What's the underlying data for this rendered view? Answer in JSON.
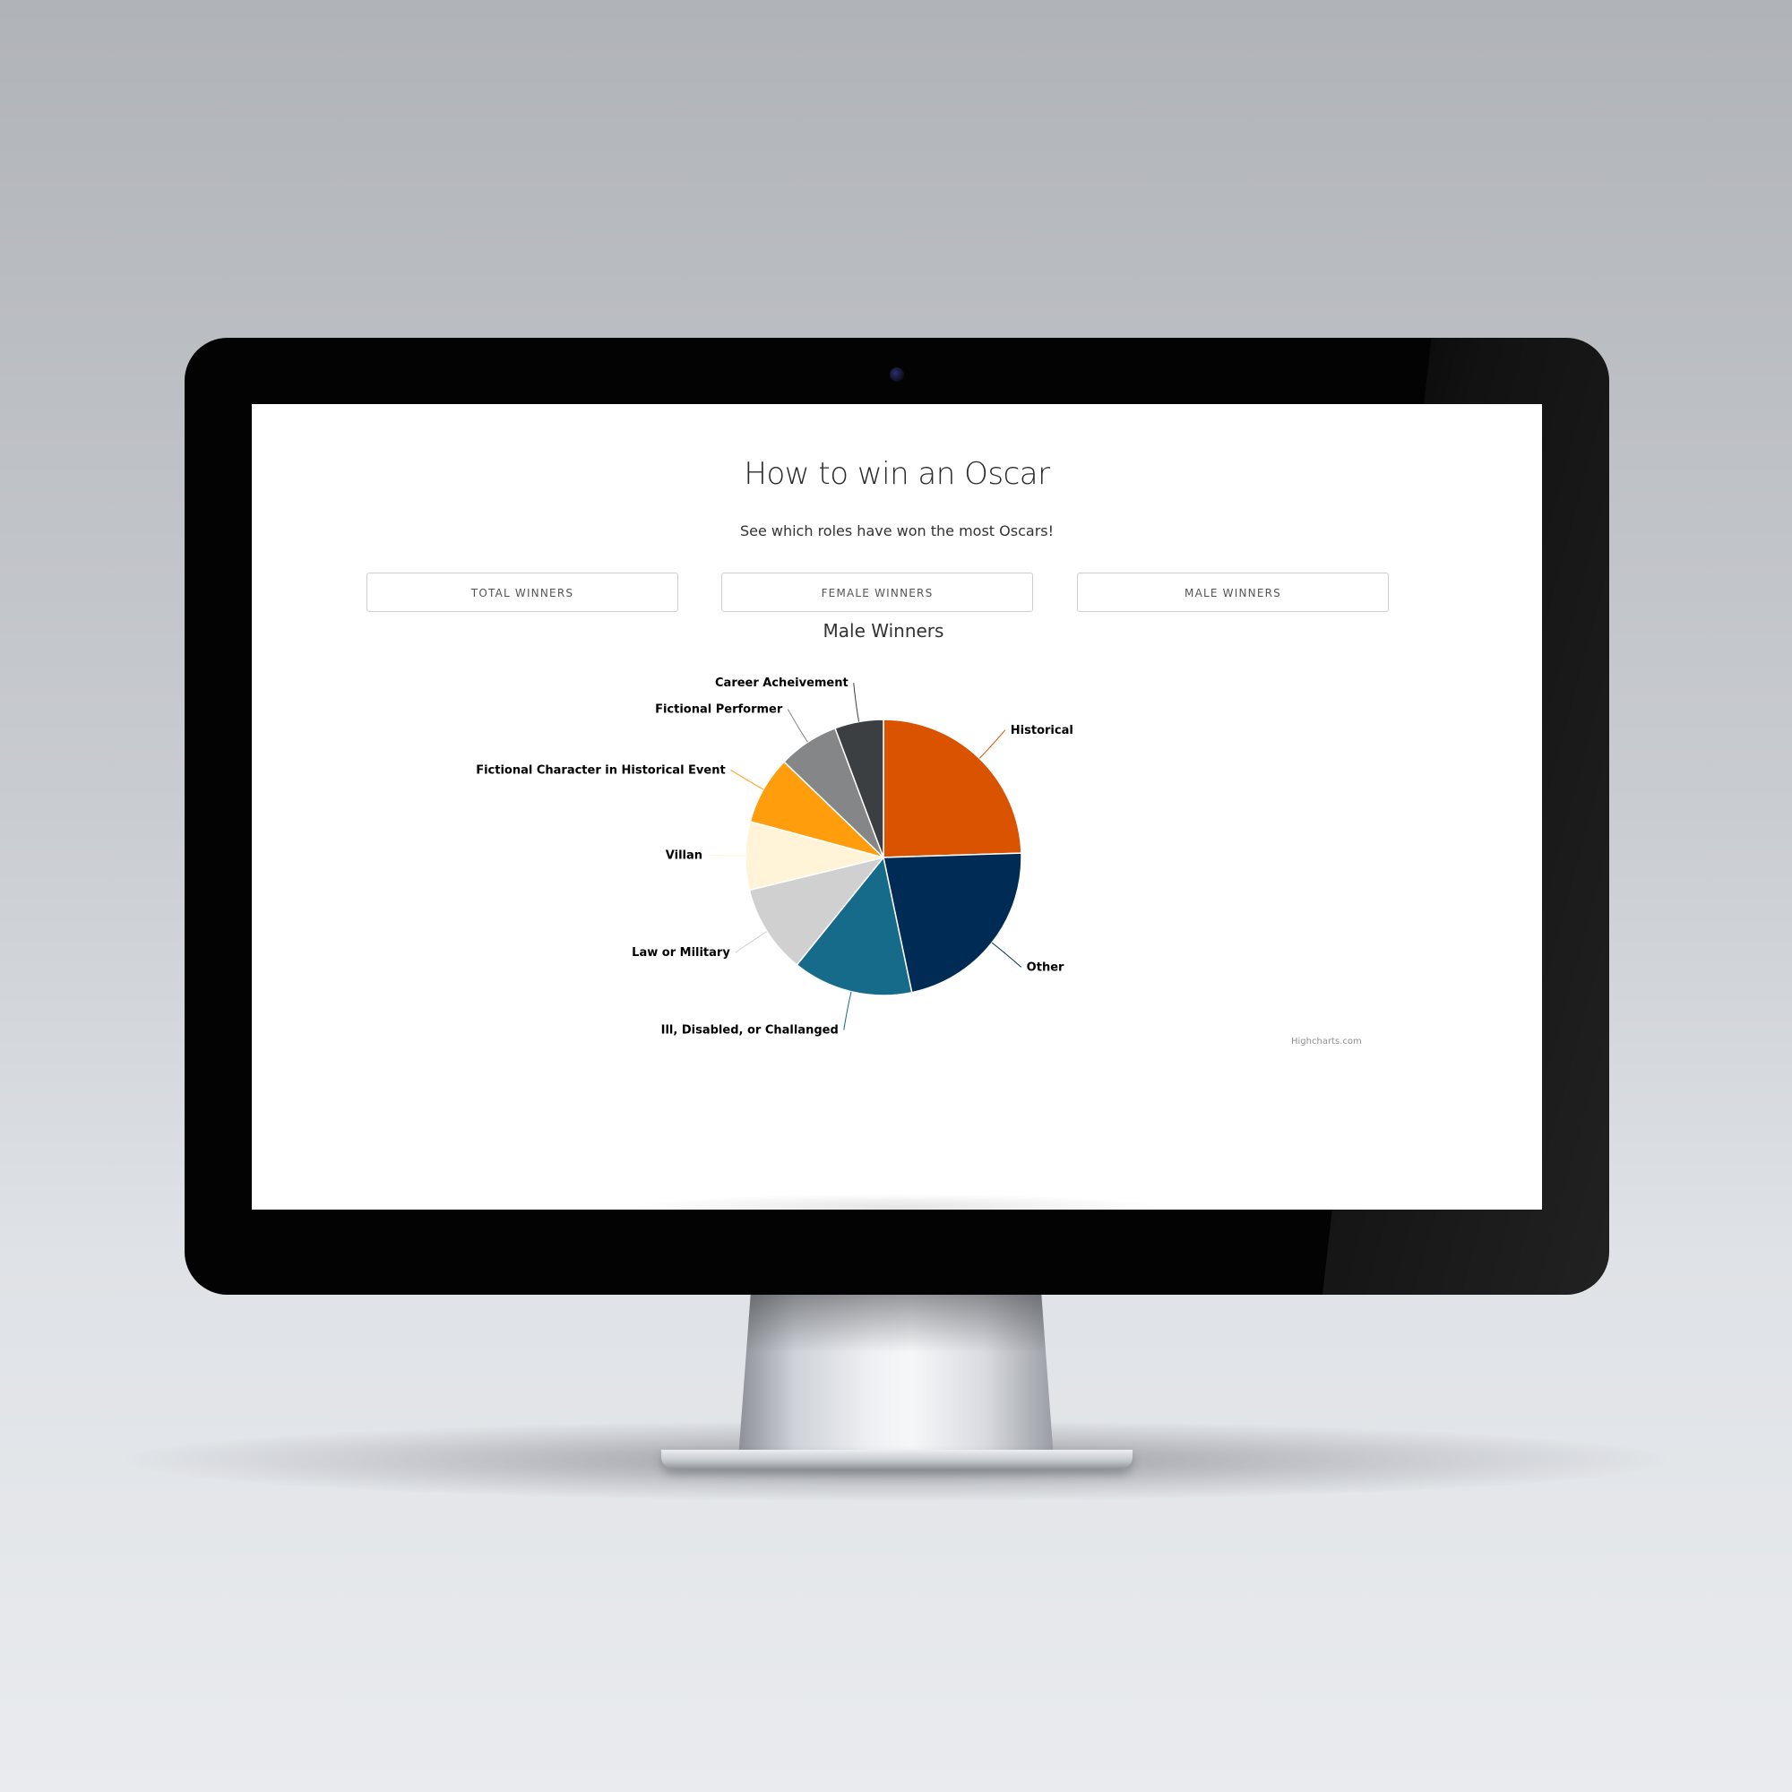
{
  "page": {
    "title": "How to win an Oscar",
    "subtitle": "See which roles have won the most Oscars!"
  },
  "buttons": {
    "total": "TOTAL WINNERS",
    "female": "FEMALE WINNERS",
    "male": "MALE WINNERS"
  },
  "credits": "Highcharts.com",
  "colors": {
    "slice_border": "#ffffff",
    "screen_background": "#ffffff",
    "bezel": "#030304"
  },
  "chart_data": {
    "type": "pie",
    "title": "Male Winners",
    "start_angle_deg": 0,
    "slices": [
      {
        "name": "Historical",
        "value": 24.5,
        "color": "#d95300"
      },
      {
        "name": "Other",
        "value": 22.2,
        "color": "#002b54"
      },
      {
        "name": "Ill, Disabled, or Challanged",
        "value": 14.1,
        "color": "#176b8a"
      },
      {
        "name": "Law or Military",
        "value": 10.4,
        "color": "#d0d0d0"
      },
      {
        "name": "Villan",
        "value": 8.0,
        "color": "#fff4d8"
      },
      {
        "name": "Fictional Character in Historical Event",
        "value": 8.0,
        "color": "#ff9d0d"
      },
      {
        "name": "Fictional Performer",
        "value": 7.1,
        "color": "#858687"
      },
      {
        "name": "Career Acheivement",
        "value": 5.7,
        "color": "#3b3f42"
      }
    ]
  }
}
